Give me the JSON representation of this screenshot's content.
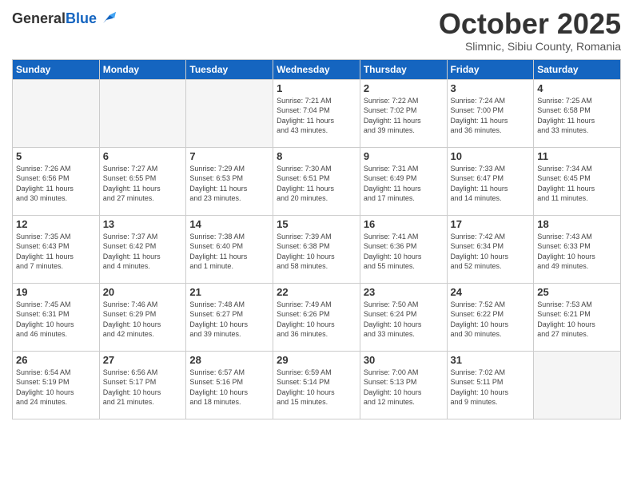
{
  "header": {
    "logo_line1": "General",
    "logo_line2": "Blue",
    "month": "October 2025",
    "location": "Slimnic, Sibiu County, Romania"
  },
  "weekdays": [
    "Sunday",
    "Monday",
    "Tuesday",
    "Wednesday",
    "Thursday",
    "Friday",
    "Saturday"
  ],
  "weeks": [
    [
      {
        "day": "",
        "info": ""
      },
      {
        "day": "",
        "info": ""
      },
      {
        "day": "",
        "info": ""
      },
      {
        "day": "1",
        "info": "Sunrise: 7:21 AM\nSunset: 7:04 PM\nDaylight: 11 hours\nand 43 minutes."
      },
      {
        "day": "2",
        "info": "Sunrise: 7:22 AM\nSunset: 7:02 PM\nDaylight: 11 hours\nand 39 minutes."
      },
      {
        "day": "3",
        "info": "Sunrise: 7:24 AM\nSunset: 7:00 PM\nDaylight: 11 hours\nand 36 minutes."
      },
      {
        "day": "4",
        "info": "Sunrise: 7:25 AM\nSunset: 6:58 PM\nDaylight: 11 hours\nand 33 minutes."
      }
    ],
    [
      {
        "day": "5",
        "info": "Sunrise: 7:26 AM\nSunset: 6:56 PM\nDaylight: 11 hours\nand 30 minutes."
      },
      {
        "day": "6",
        "info": "Sunrise: 7:27 AM\nSunset: 6:55 PM\nDaylight: 11 hours\nand 27 minutes."
      },
      {
        "day": "7",
        "info": "Sunrise: 7:29 AM\nSunset: 6:53 PM\nDaylight: 11 hours\nand 23 minutes."
      },
      {
        "day": "8",
        "info": "Sunrise: 7:30 AM\nSunset: 6:51 PM\nDaylight: 11 hours\nand 20 minutes."
      },
      {
        "day": "9",
        "info": "Sunrise: 7:31 AM\nSunset: 6:49 PM\nDaylight: 11 hours\nand 17 minutes."
      },
      {
        "day": "10",
        "info": "Sunrise: 7:33 AM\nSunset: 6:47 PM\nDaylight: 11 hours\nand 14 minutes."
      },
      {
        "day": "11",
        "info": "Sunrise: 7:34 AM\nSunset: 6:45 PM\nDaylight: 11 hours\nand 11 minutes."
      }
    ],
    [
      {
        "day": "12",
        "info": "Sunrise: 7:35 AM\nSunset: 6:43 PM\nDaylight: 11 hours\nand 7 minutes."
      },
      {
        "day": "13",
        "info": "Sunrise: 7:37 AM\nSunset: 6:42 PM\nDaylight: 11 hours\nand 4 minutes."
      },
      {
        "day": "14",
        "info": "Sunrise: 7:38 AM\nSunset: 6:40 PM\nDaylight: 11 hours\nand 1 minute."
      },
      {
        "day": "15",
        "info": "Sunrise: 7:39 AM\nSunset: 6:38 PM\nDaylight: 10 hours\nand 58 minutes."
      },
      {
        "day": "16",
        "info": "Sunrise: 7:41 AM\nSunset: 6:36 PM\nDaylight: 10 hours\nand 55 minutes."
      },
      {
        "day": "17",
        "info": "Sunrise: 7:42 AM\nSunset: 6:34 PM\nDaylight: 10 hours\nand 52 minutes."
      },
      {
        "day": "18",
        "info": "Sunrise: 7:43 AM\nSunset: 6:33 PM\nDaylight: 10 hours\nand 49 minutes."
      }
    ],
    [
      {
        "day": "19",
        "info": "Sunrise: 7:45 AM\nSunset: 6:31 PM\nDaylight: 10 hours\nand 46 minutes."
      },
      {
        "day": "20",
        "info": "Sunrise: 7:46 AM\nSunset: 6:29 PM\nDaylight: 10 hours\nand 42 minutes."
      },
      {
        "day": "21",
        "info": "Sunrise: 7:48 AM\nSunset: 6:27 PM\nDaylight: 10 hours\nand 39 minutes."
      },
      {
        "day": "22",
        "info": "Sunrise: 7:49 AM\nSunset: 6:26 PM\nDaylight: 10 hours\nand 36 minutes."
      },
      {
        "day": "23",
        "info": "Sunrise: 7:50 AM\nSunset: 6:24 PM\nDaylight: 10 hours\nand 33 minutes."
      },
      {
        "day": "24",
        "info": "Sunrise: 7:52 AM\nSunset: 6:22 PM\nDaylight: 10 hours\nand 30 minutes."
      },
      {
        "day": "25",
        "info": "Sunrise: 7:53 AM\nSunset: 6:21 PM\nDaylight: 10 hours\nand 27 minutes."
      }
    ],
    [
      {
        "day": "26",
        "info": "Sunrise: 6:54 AM\nSunset: 5:19 PM\nDaylight: 10 hours\nand 24 minutes."
      },
      {
        "day": "27",
        "info": "Sunrise: 6:56 AM\nSunset: 5:17 PM\nDaylight: 10 hours\nand 21 minutes."
      },
      {
        "day": "28",
        "info": "Sunrise: 6:57 AM\nSunset: 5:16 PM\nDaylight: 10 hours\nand 18 minutes."
      },
      {
        "day": "29",
        "info": "Sunrise: 6:59 AM\nSunset: 5:14 PM\nDaylight: 10 hours\nand 15 minutes."
      },
      {
        "day": "30",
        "info": "Sunrise: 7:00 AM\nSunset: 5:13 PM\nDaylight: 10 hours\nand 12 minutes."
      },
      {
        "day": "31",
        "info": "Sunrise: 7:02 AM\nSunset: 5:11 PM\nDaylight: 10 hours\nand 9 minutes."
      },
      {
        "day": "",
        "info": ""
      }
    ]
  ]
}
